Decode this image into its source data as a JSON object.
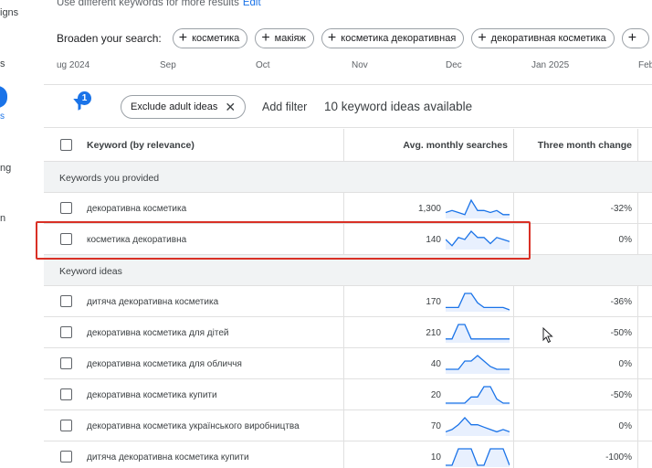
{
  "rail": {
    "items": [
      "igns",
      "s",
      "s",
      "ng",
      "n"
    ]
  },
  "notice": {
    "text": "Use different keywords for more results",
    "edit_label": "Edit"
  },
  "broaden": {
    "label": "Broaden your search:",
    "chips": [
      "косметика",
      "макіяж",
      "косметика декоративная",
      "декоративная косметика",
      ""
    ]
  },
  "timeline": [
    "ug 2024",
    "Sep",
    "Oct",
    "Nov",
    "Dec",
    "Jan 2025",
    "Feb"
  ],
  "filters": {
    "badge_count": "1",
    "exclude_label": "Exclude adult ideas",
    "add_filter": "Add filter",
    "ideas_count": "10 keyword ideas available"
  },
  "table": {
    "headers": {
      "keyword": "Keyword (by relevance)",
      "volume": "Avg. monthly searches",
      "change": "Three month change"
    },
    "provided_label": "Keywords you provided",
    "ideas_label": "Keyword ideas",
    "provided": [
      {
        "keyword": "декоративна косметика",
        "volume": "1,300",
        "change": "-32%",
        "trend": [
          2,
          3,
          2,
          1,
          8,
          3,
          3,
          2,
          3,
          1,
          1
        ]
      },
      {
        "keyword": "косметика декоративна",
        "volume": "140",
        "change": "0%",
        "trend": [
          4,
          1,
          5,
          4,
          8,
          5,
          5,
          2,
          5,
          4,
          3
        ]
      }
    ],
    "ideas": [
      {
        "keyword": "дитяча декоративна косметика",
        "volume": "170",
        "change": "-36%",
        "trend": [
          1,
          1,
          1,
          7,
          7,
          3,
          1,
          1,
          1,
          1,
          0
        ]
      },
      {
        "keyword": "декоративна косметика для дітей",
        "volume": "210",
        "change": "-50%",
        "trend": [
          1,
          1,
          8,
          8,
          1,
          1,
          1,
          1,
          1,
          1,
          1
        ]
      },
      {
        "keyword": "декоративна косметика для обличчя",
        "volume": "40",
        "change": "0%",
        "trend": [
          1,
          1,
          1,
          4,
          4,
          6,
          4,
          2,
          1,
          1,
          1
        ]
      },
      {
        "keyword": "декоративна косметика купити",
        "volume": "20",
        "change": "-50%",
        "trend": [
          0,
          0,
          0,
          0,
          3,
          3,
          8,
          8,
          2,
          0,
          0
        ]
      },
      {
        "keyword": "декоративна косметика українського виробництва",
        "volume": "70",
        "change": "0%",
        "trend": [
          1,
          2,
          4,
          7,
          4,
          4,
          3,
          2,
          1,
          2,
          1
        ]
      },
      {
        "keyword": "дитяча декоративна косметика купити",
        "volume": "10",
        "change": "-100%",
        "trend": [
          0,
          0,
          8,
          8,
          8,
          0,
          0,
          8,
          8,
          8,
          0
        ]
      }
    ]
  }
}
